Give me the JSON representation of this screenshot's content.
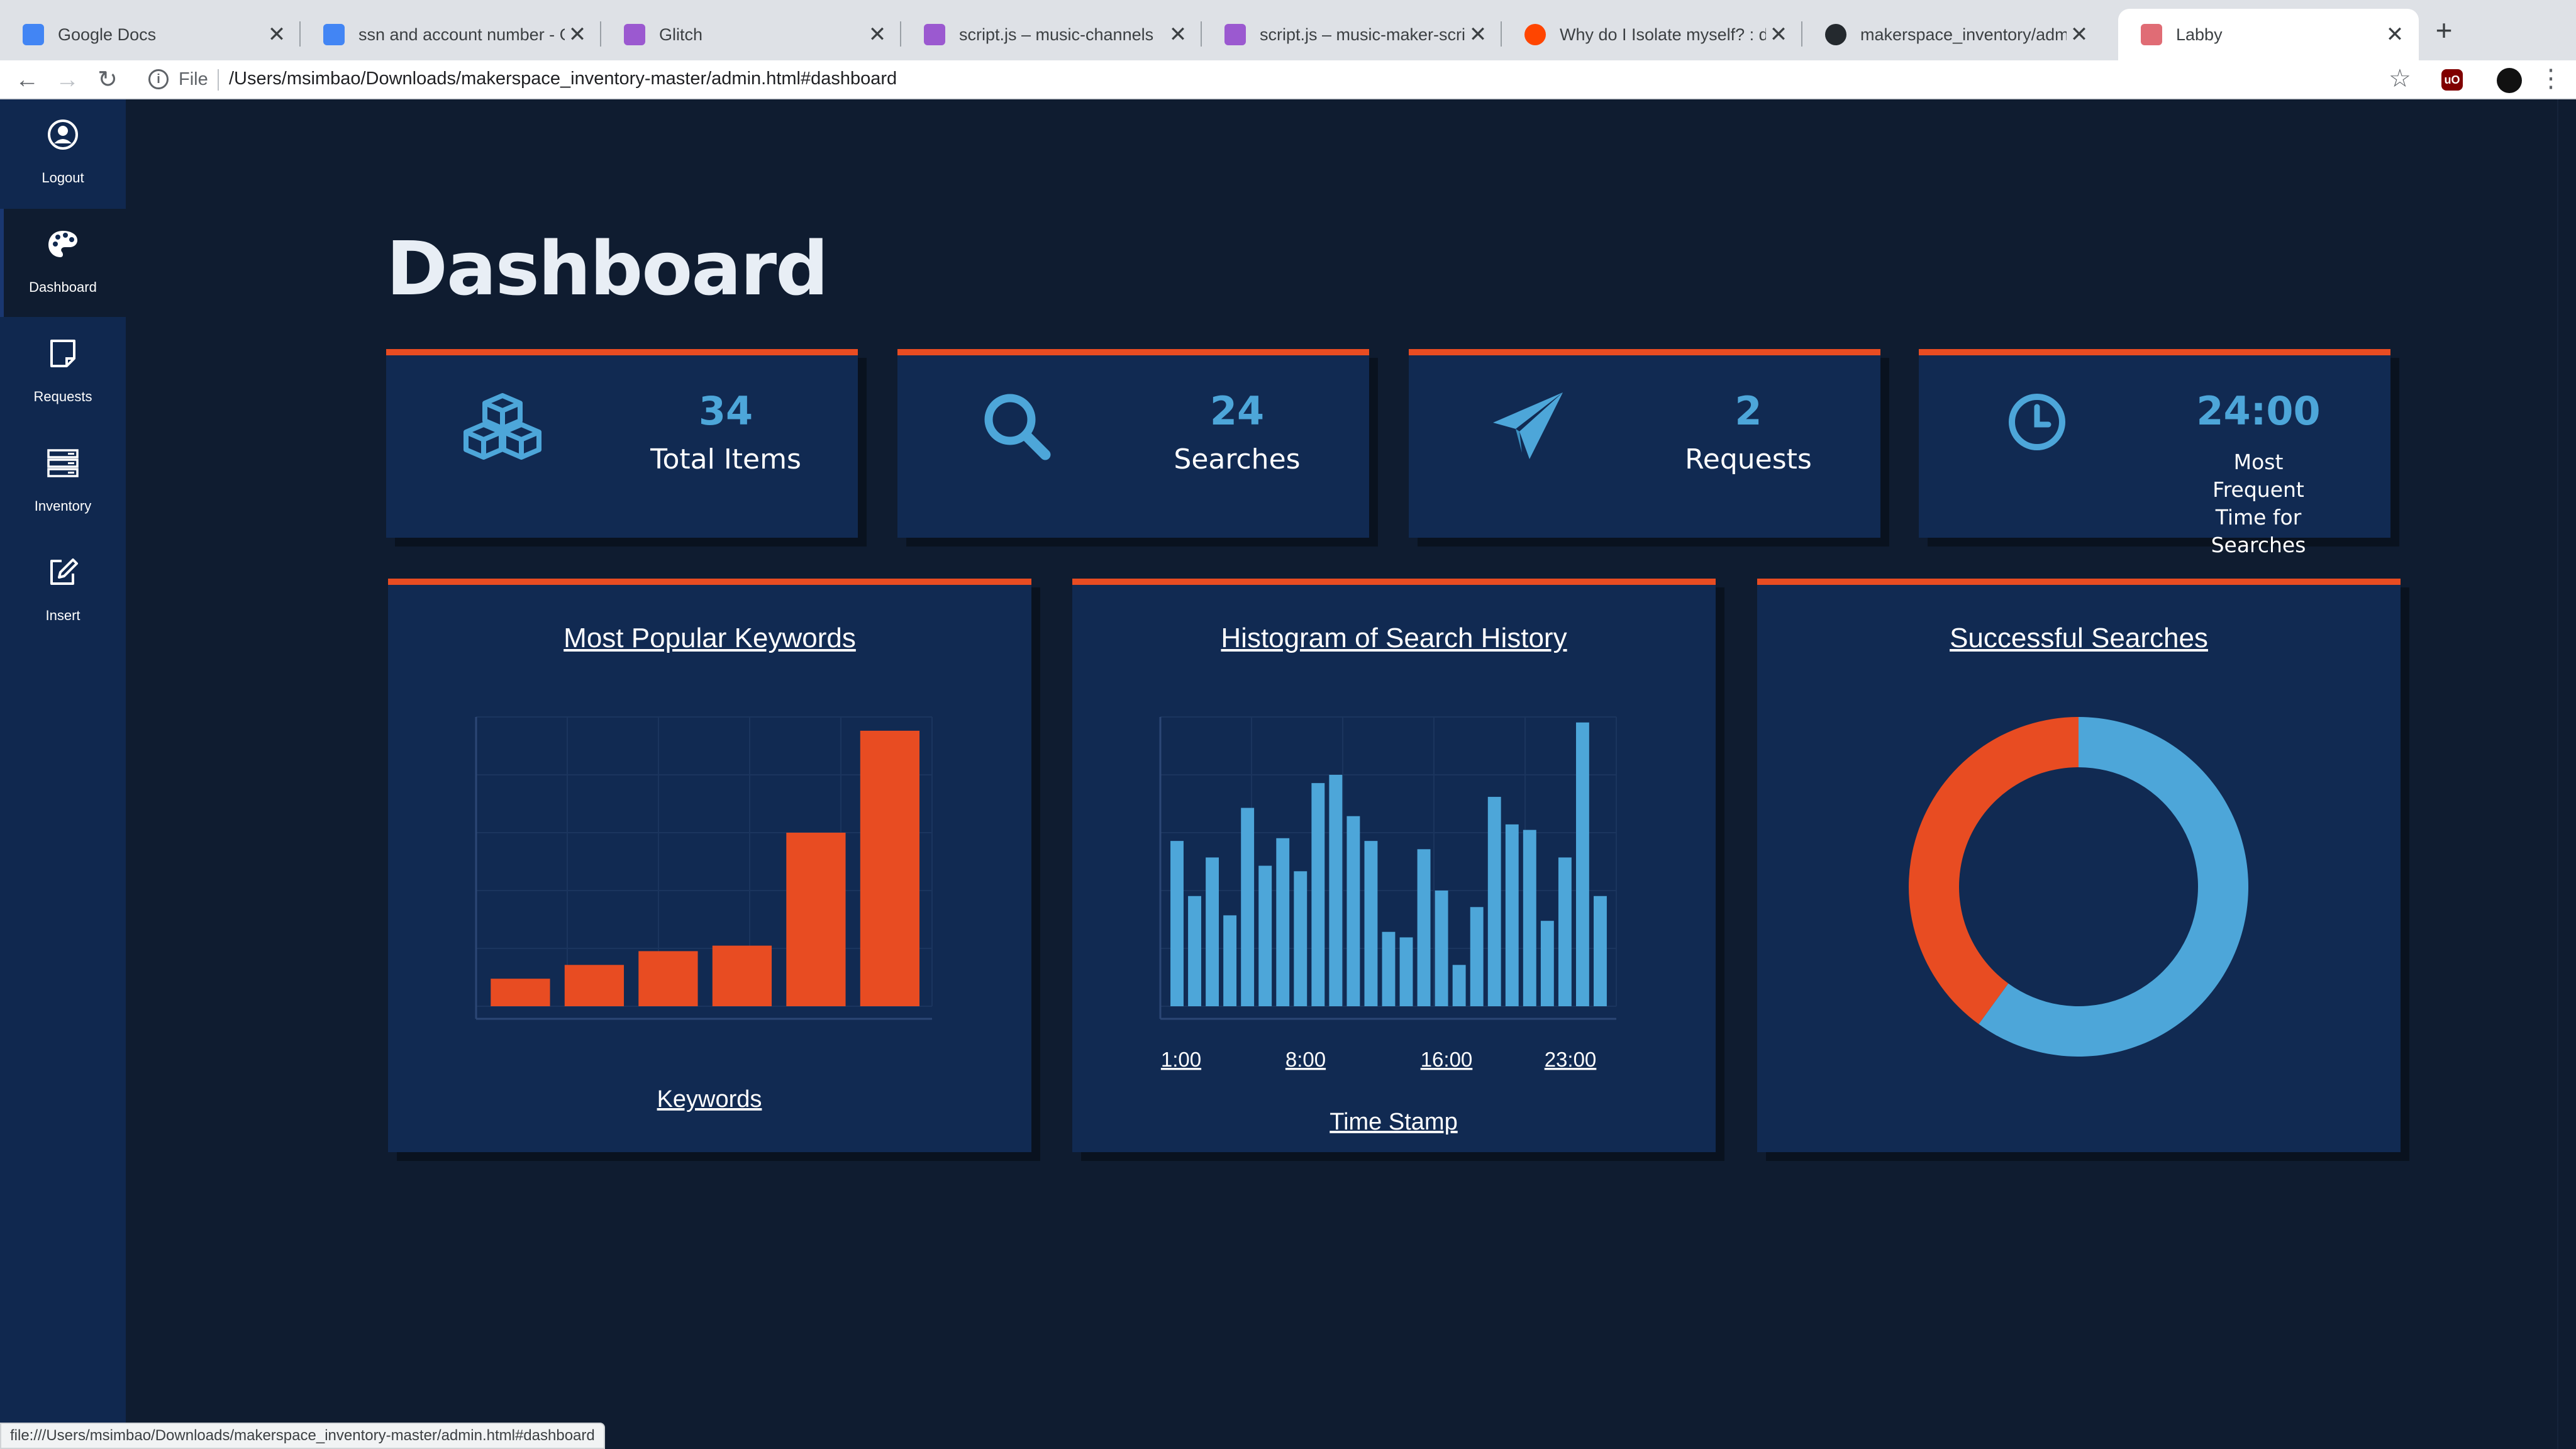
{
  "browser": {
    "tabs": [
      {
        "title": "Google Docs",
        "icon": "google-docs-icon",
        "color": "#4285f4"
      },
      {
        "title": "ssn and account number - Goo",
        "icon": "google-docs-icon",
        "color": "#4285f4"
      },
      {
        "title": "Glitch",
        "icon": "glitch-icon",
        "color": "#9b59d0"
      },
      {
        "title": "script.js – music-channels",
        "icon": "glitch-icon",
        "color": "#9b59d0"
      },
      {
        "title": "script.js – music-maker-scribb",
        "icon": "glitch-icon",
        "color": "#9b59d0"
      },
      {
        "title": "Why do I Isolate myself? : depr",
        "icon": "reddit-icon",
        "color": "#ff4500"
      },
      {
        "title": "makerspace_inventory/admin.j",
        "icon": "github-icon",
        "color": "#24292e"
      },
      {
        "title": "Labby",
        "icon": "labby-icon",
        "color": "#e06c75"
      }
    ],
    "new_tab": "+",
    "close_glyph": "✕",
    "omnibox": {
      "scheme_label": "File",
      "url": "/Users/msimbao/Downloads/makerspace_inventory-master/admin.html#dashboard"
    },
    "status_url": "file:///Users/msimbao/Downloads/makerspace_inventory-master/admin.html#dashboard"
  },
  "sidebar": {
    "items": [
      {
        "label": "Logout",
        "icon": "user-icon"
      },
      {
        "label": "Dashboard",
        "icon": "palette-icon"
      },
      {
        "label": "Requests",
        "icon": "sticky-note-icon"
      },
      {
        "label": "Inventory",
        "icon": "server-icon"
      },
      {
        "label": "Insert",
        "icon": "edit-icon"
      }
    ],
    "active": "Dashboard"
  },
  "page": {
    "title": "Dashboard"
  },
  "stats": [
    {
      "value": "34",
      "label": "Total Items",
      "icon": "cubes-icon"
    },
    {
      "value": "24",
      "label": "Searches",
      "icon": "search-icon"
    },
    {
      "value": "2",
      "label": "Requests",
      "icon": "paper-plane-icon"
    },
    {
      "value": "24:00",
      "label": "Most Frequent Time for Searches",
      "icon": "clock-icon"
    }
  ],
  "colors": {
    "accent": "#e84c22",
    "blue": "#4da6d9",
    "card": "#112a52",
    "background": "#0f1c30",
    "sidebar": "#10284f"
  },
  "chart_data": [
    {
      "type": "bar",
      "title": "Most Popular Keywords",
      "xlabel": "Keywords",
      "ylabel": "",
      "categories": [
        "",
        "",
        "",
        "",
        "",
        ""
      ],
      "values": [
        1,
        1.5,
        2,
        2.2,
        6.3,
        10
      ],
      "ylim": [
        0,
        10.5
      ],
      "color": "#e84c22",
      "grid": true
    },
    {
      "type": "bar",
      "title": "Histogram of Search History",
      "xlabel": "Time Stamp",
      "ylabel": "",
      "x_ticks": [
        "1:00",
        "8:00",
        "16:00",
        "23:00"
      ],
      "values": [
        6,
        4,
        5.4,
        3.3,
        7.2,
        5.1,
        6.1,
        4.9,
        8.1,
        8.4,
        6.9,
        6,
        2.7,
        2.5,
        5.7,
        4.2,
        1.5,
        3.6,
        7.6,
        6.6,
        6.4,
        3.1,
        5.4,
        10.3,
        4
      ],
      "ylim": [
        0,
        10.5
      ],
      "color": "#4da6d9",
      "grid": true
    },
    {
      "type": "pie",
      "title": "Successful Searches",
      "labels": [
        "",
        ""
      ],
      "values": [
        60,
        40
      ],
      "colors": [
        "#4da6d9",
        "#e84c22"
      ],
      "donut": true
    }
  ]
}
